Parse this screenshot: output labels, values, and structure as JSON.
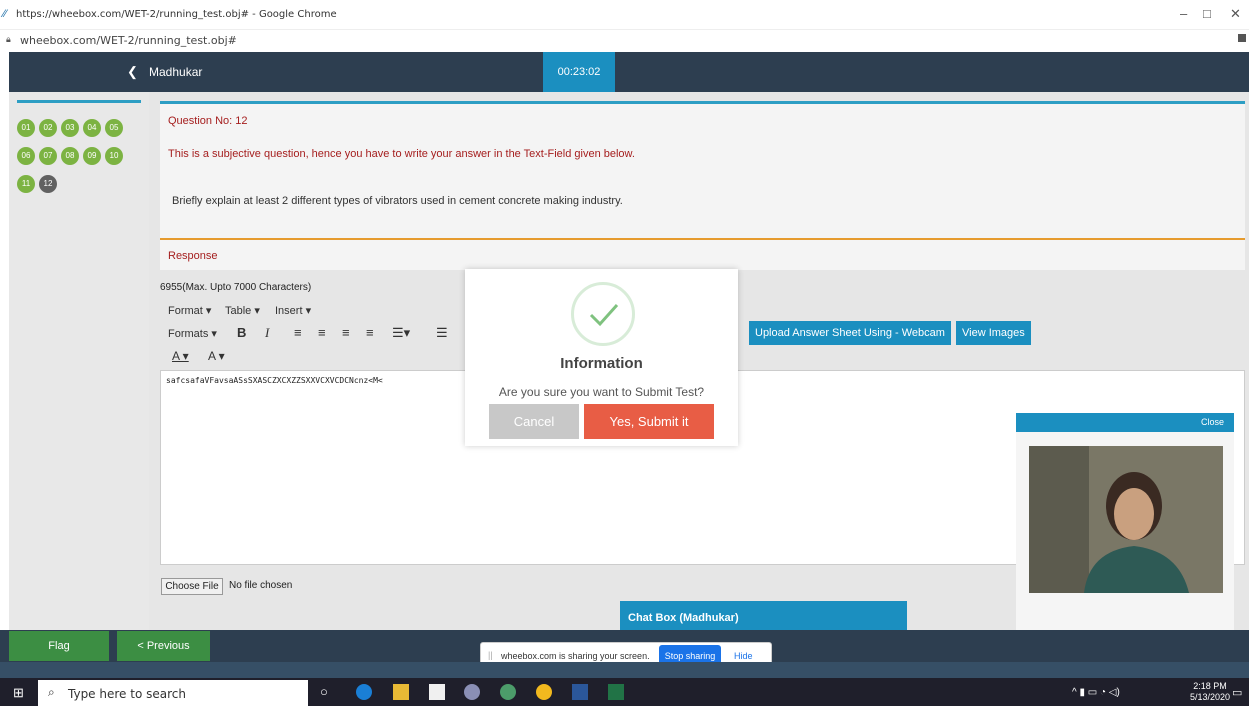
{
  "browser": {
    "title": "https://wheebox.com/WET-2/running_test.obj# - Google Chrome",
    "url": "wheebox.com/WET-2/running_test.obj#"
  },
  "header": {
    "username": "Madhukar",
    "timer": "00:23:02"
  },
  "questions": {
    "numbers": [
      "01",
      "02",
      "03",
      "04",
      "05",
      "06",
      "07",
      "08",
      "09",
      "10",
      "11",
      "12"
    ],
    "current": "12"
  },
  "question": {
    "number_label": "Question No: 12",
    "note": "This is a subjective question, hence you have to write your answer in the Text-Field given below.",
    "text": "Briefly explain at least 2 different types of vibrators used in cement concrete making industry."
  },
  "response": {
    "label": "Response",
    "char_count": "6955(Max. Upto 7000 Characters)",
    "menus": [
      "Format ▾",
      "Table ▾",
      "Insert ▾"
    ],
    "formats": "Formats ▾",
    "answer_text": "safcsafaVFavsaASsSXASCZXCXZZSXXVCXVCDCNcnz<M<",
    "upload_webcam": "Upload Answer Sheet Using - Webcam",
    "view_images": "View Images",
    "choose_file": "Choose File",
    "no_file": "No file chosen"
  },
  "chat": {
    "title": "Chat Box (Madhukar)"
  },
  "camera": {
    "close": "Close"
  },
  "footer": {
    "flag": "Flag",
    "previous": "< Previous"
  },
  "share_bar": {
    "message": "wheebox.com is sharing your screen.",
    "stop": "Stop sharing",
    "hide": "Hide"
  },
  "taskbar": {
    "search_placeholder": "Type here to search",
    "time": "2:18 PM",
    "date": "5/13/2020"
  },
  "modal": {
    "title": "Information",
    "message": "Are you sure you want to Submit Test?",
    "cancel": "Cancel",
    "confirm": "Yes, Submit it",
    "icon": "check-icon"
  },
  "colors": {
    "header_bg": "#2d3e50",
    "accent_blue": "#1b8fc0",
    "answered_green": "#7cb342",
    "confirm_red": "#e85d45",
    "question_red": "#a51e1e"
  }
}
